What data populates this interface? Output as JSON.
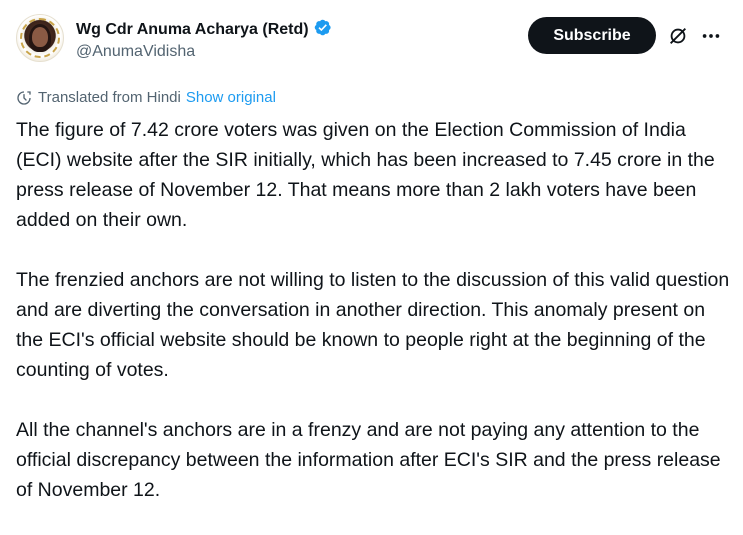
{
  "author": {
    "display_name": "Wg Cdr Anuma Acharya (Retd)",
    "handle": "@AnumaVidisha",
    "verified": true
  },
  "actions": {
    "subscribe_label": "Subscribe",
    "grok_icon": "grok-icon",
    "more_icon": "more-icon"
  },
  "translation": {
    "note": "Translated from Hindi",
    "show_original": "Show original",
    "icon": "translate-icon"
  },
  "tweet": {
    "paragraphs": [
      "The figure of 7.42 crore voters was given on the Election Commission of India (ECI) website after the SIR initially, which has been increased to 7.45 crore in the press release of November 12. That means more than 2 lakh voters have been added on their own.",
      "The frenzied anchors are not willing to listen to the discussion of this valid question and are diverting the conversation in another direction. This anomaly present on the ECI's official website should be known to people right at the beginning of the counting of votes.",
      "All the channel's anchors are in a frenzy and are not paying any attention to the official discrepancy between the information after ECI's SIR and the press release of November 12."
    ]
  },
  "colors": {
    "text": "#0f1419",
    "secondary": "#536471",
    "link": "#1d9bf0",
    "button_bg": "#0f1419"
  }
}
